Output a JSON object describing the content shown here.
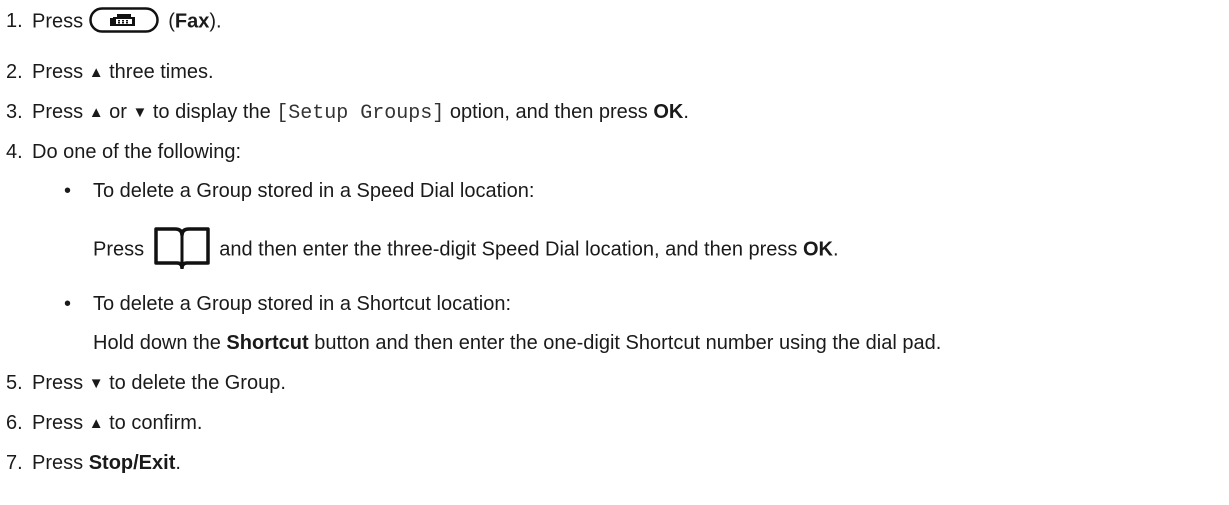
{
  "steps": [
    {
      "num": "1.",
      "pre": "Press",
      "icon": "fax-button-icon",
      "open": " (",
      "bold": "Fax",
      "close": ")."
    },
    {
      "num": "2.",
      "pre": "Press ",
      "arrow": "▲",
      "post": " three times."
    },
    {
      "num": "3.",
      "pre": "Press ",
      "arrow_up": "▲",
      "mid": " or ",
      "arrow_down": "▼",
      "mid2": " to display the ",
      "code": "[Setup Groups]",
      "mid3": " option, and then press ",
      "bold": "OK",
      "end": "."
    },
    {
      "num": "4.",
      "text": "Do one of the following:"
    },
    {
      "num": "5.",
      "pre": "Press ",
      "arrow": "▼",
      "post": " to delete the Group."
    },
    {
      "num": "6.",
      "pre": "Press ",
      "arrow": "▲",
      "post": " to confirm."
    },
    {
      "num": "7.",
      "pre": "Press ",
      "bold": "Stop/Exit",
      "end": "."
    }
  ],
  "options": [
    {
      "bullet": "•",
      "heading": "To delete a Group stored in a Speed Dial location:",
      "pre": "Press",
      "icon": "address-book-icon",
      "post": "and then enter the three-digit Speed Dial location, and then press ",
      "bold": "OK",
      "end": "."
    },
    {
      "bullet": "•",
      "heading": "To delete a Group stored in a Shortcut location:",
      "pre": "Hold down the ",
      "bold": "Shortcut",
      "post": " button and then enter the one-digit Shortcut number using the dial pad."
    }
  ]
}
